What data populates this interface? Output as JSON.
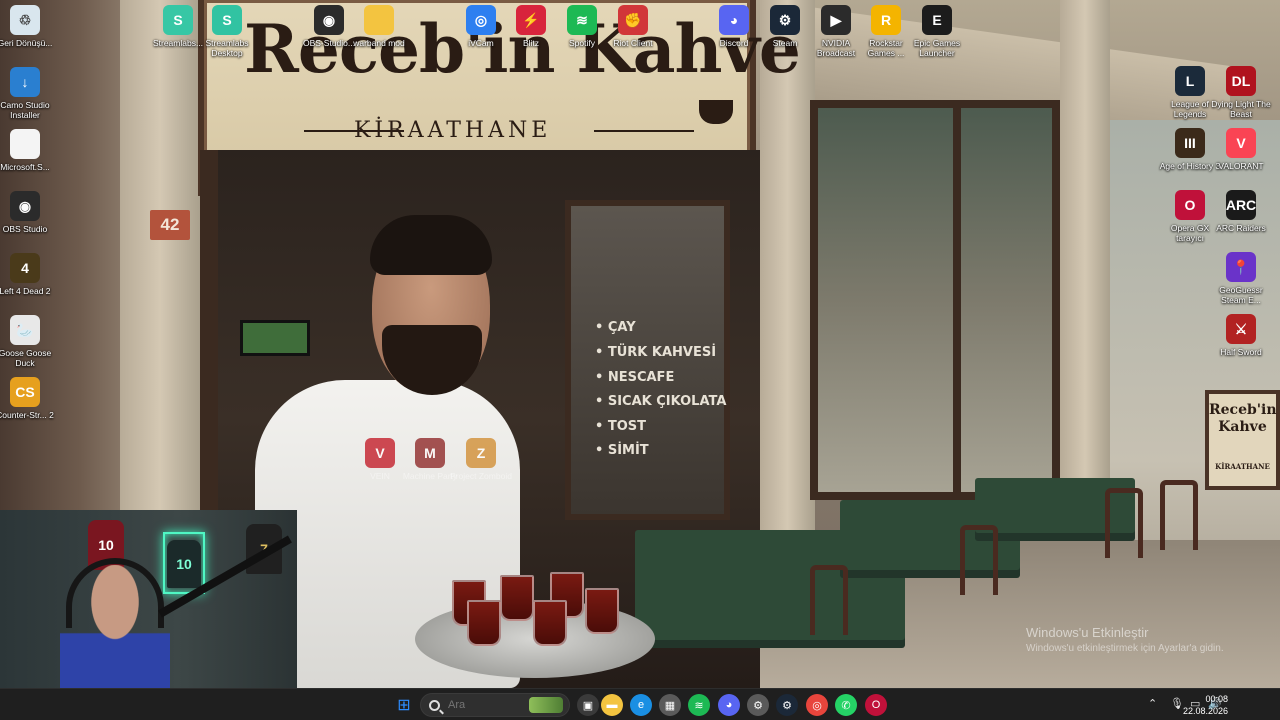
{
  "wallpaper": {
    "sign_title": "Receb'in Kahve",
    "sign_subtitle": "KİRAATHANE",
    "door_number": "42",
    "menu": [
      "• ÇAY",
      "• TÜRK KAHVESİ",
      "• NESCAFE",
      "• SICAK ÇIKOLATA",
      "• TOST",
      "• SİMİT"
    ],
    "stand_sign": "Receb'in Kahve",
    "stand_sign_sub": "KİRAATHANE",
    "activation_title": "Windows'u Etkinleştir",
    "activation_text": "Windows'u etkinleştirmek için Ayarlar'a gidin."
  },
  "desktop_icons": {
    "top": [
      {
        "label": "Streamlabs...",
        "icon": "streamlabs-icon",
        "color": "#37c7a5",
        "glyph": "S"
      },
      {
        "label": "Streamlabs Desktop",
        "icon": "streamlabs-desktop-icon",
        "color": "#31c3a2",
        "glyph": "S"
      },
      {
        "label": "OBS-Studio...",
        "icon": "obs-icon",
        "color": "#2b2b2b",
        "glyph": "◉"
      },
      {
        "label": "warband mod",
        "icon": "folder-icon",
        "color": "#f3c440",
        "glyph": ""
      },
      {
        "label": "iVCam",
        "icon": "ivcam-icon",
        "color": "#2d7ff0",
        "glyph": "◎"
      },
      {
        "label": "Blitz",
        "icon": "blitz-icon",
        "color": "#d8243c",
        "glyph": "⚡"
      },
      {
        "label": "Spotify",
        "icon": "spotify-icon",
        "color": "#1db954",
        "glyph": "≋"
      },
      {
        "label": "Riot Client",
        "icon": "riot-icon",
        "color": "#d13639",
        "glyph": "✊"
      },
      {
        "label": "Discord",
        "icon": "discord-icon",
        "color": "#5865f2",
        "glyph": "◕"
      },
      {
        "label": "Steam",
        "icon": "steam-icon",
        "color": "#1b2838",
        "glyph": "⚙"
      },
      {
        "label": "NVIDIA Broadcast",
        "icon": "nvidia-icon",
        "color": "#2b2b2b",
        "glyph": "▶"
      },
      {
        "label": "Rockstar Games ...",
        "icon": "rockstar-icon",
        "color": "#f4b400",
        "glyph": "R"
      },
      {
        "label": "Epic Games Launcher",
        "icon": "epic-icon",
        "color": "#1c1c1c",
        "glyph": "E"
      }
    ],
    "left": [
      {
        "label": "Geri Dönüşü...",
        "icon": "recycle-bin-icon",
        "color": "#d9e6ee",
        "glyph": "♲"
      },
      {
        "label": "Camo Studio Installer",
        "icon": "camo-icon",
        "color": "#2a7fd0",
        "glyph": "↓"
      },
      {
        "label": "Microsoft.S...",
        "icon": "file-icon",
        "color": "#f4f4f4",
        "glyph": ""
      },
      {
        "label": "OBS Studio",
        "icon": "obs-studio-icon",
        "color": "#2b2b2b",
        "glyph": "◉"
      },
      {
        "label": "Left 4 Dead 2",
        "icon": "l4d2-icon",
        "color": "#4a3a1a",
        "glyph": "4"
      },
      {
        "label": "Goose Goose Duck",
        "icon": "goose-icon",
        "color": "#e8e8e8",
        "glyph": "🦢"
      },
      {
        "label": "Counter-Str... 2",
        "icon": "cs2-icon",
        "color": "#e6a01e",
        "glyph": "CS"
      }
    ],
    "right_col1": [
      {
        "label": "League of Legends",
        "icon": "lol-icon",
        "color": "#1b2a3a",
        "glyph": "L"
      },
      {
        "label": "Age of History 3",
        "icon": "aoh3-icon",
        "color": "#3b2a1a",
        "glyph": "III"
      },
      {
        "label": "Opera GX tarayıcı",
        "icon": "operagx-icon",
        "color": "#c0113a",
        "glyph": "O"
      }
    ],
    "right_col2": [
      {
        "label": "Dying Light The Beast",
        "icon": "dying-light-icon",
        "color": "#b0121e",
        "glyph": "DL"
      },
      {
        "label": "VALORANT",
        "icon": "valorant-icon",
        "color": "#fa4454",
        "glyph": "V"
      },
      {
        "label": "ARC Raiders",
        "icon": "arc-raiders-icon",
        "color": "#1a1a1a",
        "glyph": "ARC"
      },
      {
        "label": "GeoGuessr Steam E...",
        "icon": "geoguessr-icon",
        "color": "#6a33c9",
        "glyph": "📍"
      },
      {
        "label": "Half Sword",
        "icon": "half-sword-icon",
        "color": "#b22222",
        "glyph": "⚔"
      }
    ],
    "mid": [
      {
        "label": "VEIN",
        "icon": "vein-icon",
        "color": "#c1121f",
        "glyph": "V"
      },
      {
        "label": "Machine Party",
        "icon": "machine-party-icon",
        "color": "#8a1e1e",
        "glyph": "M"
      },
      {
        "label": "Project Zomboid",
        "icon": "zomboid-icon",
        "color": "#d0892a",
        "glyph": "Z"
      }
    ]
  },
  "webcam": {
    "jersey_left": "10",
    "jersey_neon": "10",
    "jersey_right": "7"
  },
  "taskbar": {
    "search_placeholder": "Ara",
    "apps": [
      {
        "name": "start-icon",
        "color": "#2d8cff",
        "glyph": "⊞"
      },
      {
        "name": "task-view-icon",
        "color": "#3a3a3a",
        "glyph": "▣"
      },
      {
        "name": "file-explorer-icon",
        "color": "#f3c440",
        "glyph": "▬"
      },
      {
        "name": "edge-icon",
        "color": "#1a8fe3",
        "glyph": "e"
      },
      {
        "name": "store-icon",
        "color": "#5a5a5a",
        "glyph": "▦"
      },
      {
        "name": "spotify-taskbar-icon",
        "color": "#1db954",
        "glyph": "≋"
      },
      {
        "name": "discord-taskbar-icon",
        "color": "#5865f2",
        "glyph": "◕"
      },
      {
        "name": "settings-icon",
        "color": "#5a5a5a",
        "glyph": "⚙"
      },
      {
        "name": "steam-taskbar-icon",
        "color": "#1b2838",
        "glyph": "⚙"
      },
      {
        "name": "chrome-icon",
        "color": "#e8453c",
        "glyph": "◎"
      },
      {
        "name": "whatsapp-icon",
        "color": "#25d366",
        "glyph": "✆"
      },
      {
        "name": "opera-taskbar-icon",
        "color": "#c0113a",
        "glyph": "O"
      }
    ],
    "time": "00:08",
    "date": "22.08.2026"
  }
}
